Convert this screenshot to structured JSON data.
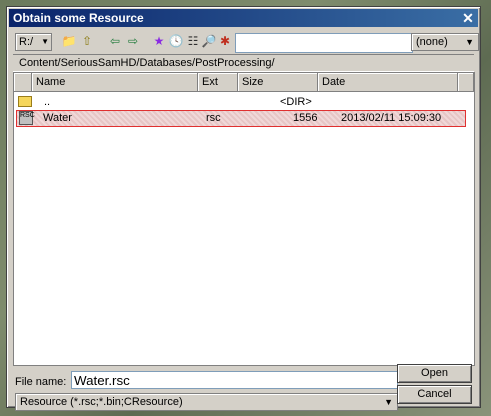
{
  "window": {
    "title": "Obtain some Resource",
    "close_glyph": "✕"
  },
  "toolbar": {
    "drive": "R:/",
    "drive_arrow": "▼",
    "icons": [
      {
        "name": "new-folder-icon",
        "glyph": "📁",
        "color": "#c8a020"
      },
      {
        "name": "folder-up-icon",
        "glyph": "⇧",
        "color": "#8a7a10"
      },
      {
        "name": "back-icon",
        "glyph": "⇦",
        "color": "#1f7a3a"
      },
      {
        "name": "forward-icon",
        "glyph": "⇨",
        "color": "#1f7a3a"
      },
      {
        "name": "favorite-star-icon",
        "glyph": "★",
        "color": "#8a2be2"
      },
      {
        "name": "history-clock-icon",
        "glyph": "🕓",
        "color": "#2050a0"
      },
      {
        "name": "details-view-icon",
        "glyph": "☷",
        "color": "#303030"
      },
      {
        "name": "search-icon",
        "glyph": "🔎",
        "color": "#404040"
      },
      {
        "name": "delete-icon",
        "glyph": "✱",
        "color": "#c03020"
      }
    ],
    "filter_value": "",
    "filter_select": "(none)",
    "filter_arrow": "▼"
  },
  "path": "Content/SeriousSamHD/Databases/PostProcessing/",
  "columns": [
    "Name",
    "Ext",
    "Size",
    "Date"
  ],
  "rows": [
    {
      "name": "..",
      "ext": "",
      "size": "<DIR>",
      "date": "",
      "icon": "folder-icon"
    },
    {
      "name": "Water",
      "ext": "rsc",
      "size": "1556",
      "date": "2013/02/11 15:09:30",
      "icon": "rsc-file-icon",
      "selected": true
    }
  ],
  "footer": {
    "filename_label": "File name:",
    "filename_value": "Water.rsc",
    "filetype": "Resource (*.rsc;*.bin;CResource)",
    "filetype_arrow": "▼",
    "open_label": "Open",
    "cancel_label": "Cancel"
  },
  "rsc_icon_text": "RSC"
}
